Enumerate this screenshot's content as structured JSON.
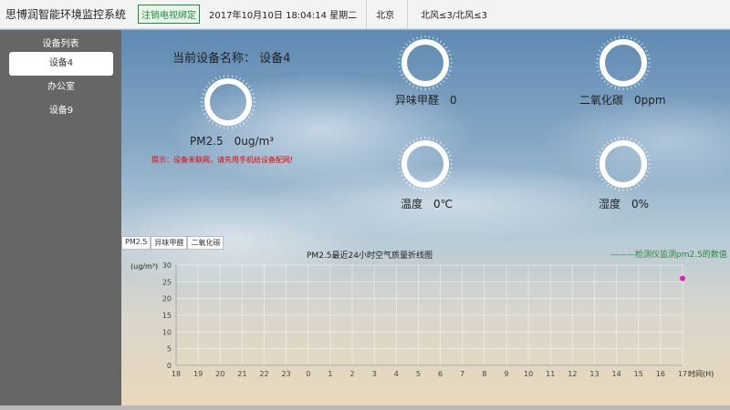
{
  "header": {
    "app_title": "思博润智能环境监控系统",
    "unbind_button": "注销电视绑定",
    "datetime": "2017年10月10日 18:04:14 星期二",
    "city": "北京",
    "wind": "北风≤3/北风≤3"
  },
  "sidebar": {
    "title": "设备列表",
    "items": [
      {
        "label": "设备4",
        "active": true
      },
      {
        "label": "办公室",
        "active": false
      },
      {
        "label": "设备9",
        "active": false
      }
    ]
  },
  "main": {
    "device_title": "当前设备名称： 设备4",
    "readings": {
      "pm25": "PM2.5　0ug/m³",
      "formaldehyde": "异味甲醛　0",
      "co2": "二氧化碳　0ppm",
      "temperature": "温度　0℃",
      "humidity": "湿度　0%"
    },
    "warning": "提示：设备未联网，请先用手机给设备配网!"
  },
  "chart_tabs": [
    "PM2.5",
    "异味甲醛",
    "二氧化碳"
  ],
  "chart_data": {
    "type": "line",
    "title": "PM2.5最近24小时空气质量折线图",
    "legend": "———检测仪监测pm2.5的数值",
    "ylabel": "(ug/m³)",
    "xlabel": "时间(H)",
    "ylim": [
      0,
      30
    ],
    "yticks": [
      "0",
      "5",
      "10",
      "15",
      "20",
      "25",
      "30"
    ],
    "categories": [
      "18",
      "19",
      "20",
      "21",
      "22",
      "23",
      "0",
      "1",
      "2",
      "3",
      "4",
      "5",
      "6",
      "7",
      "8",
      "9",
      "10",
      "11",
      "12",
      "13",
      "14",
      "15",
      "16",
      "17"
    ],
    "series": [
      {
        "values": [
          null,
          null,
          null,
          null,
          null,
          null,
          null,
          null,
          null,
          null,
          null,
          null,
          null,
          null,
          null,
          null,
          null,
          null,
          null,
          null,
          null,
          null,
          null,
          26
        ],
        "color": "#e020b0"
      }
    ]
  }
}
